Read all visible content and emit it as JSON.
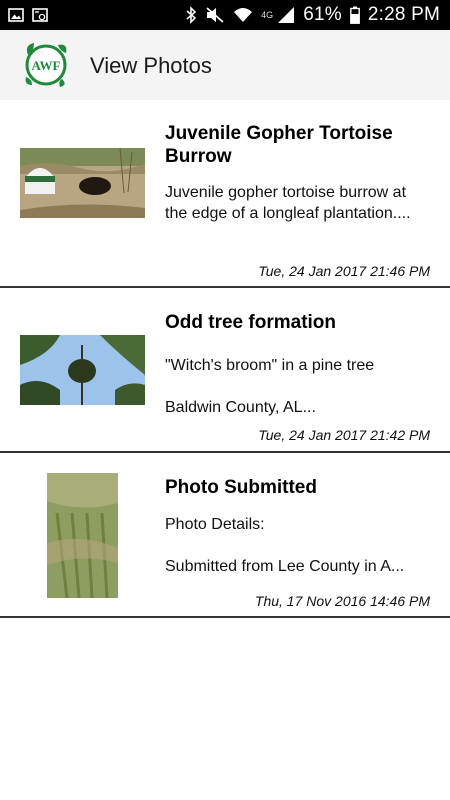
{
  "status_bar": {
    "network_type": "4G",
    "battery": "61%",
    "time": "2:28 PM"
  },
  "app_bar": {
    "logo_text": "AWF",
    "title": "View Photos"
  },
  "photos": [
    {
      "title": "Juvenile Gopher Tortoise Burrow",
      "description": "Juvenile gopher tortoise burrow at the edge of a longleaf plantation....",
      "date": "Tue, 24 Jan 2017 21:46 PM"
    },
    {
      "title": "Odd tree formation",
      "description": "\"Witch's broom\" in a pine tree\n\nBaldwin County, AL...",
      "date": "Tue, 24 Jan 2017 21:42 PM"
    },
    {
      "title": "Photo Submitted",
      "description": "Photo Details:\n\nSubmitted from Lee County in A...",
      "date": "Thu, 17 Nov 2016 14:46 PM"
    }
  ],
  "icons": {
    "status_left": [
      "image-icon",
      "screenshot-icon"
    ],
    "status_right": [
      "bluetooth-icon",
      "mute-icon",
      "wifi-icon",
      "signal-icon",
      "battery-icon"
    ]
  },
  "colors": {
    "status_bar": "#000000",
    "app_bar": "#f4f4f4",
    "logo_green": "#1e8a3a",
    "divider": "#333333"
  }
}
